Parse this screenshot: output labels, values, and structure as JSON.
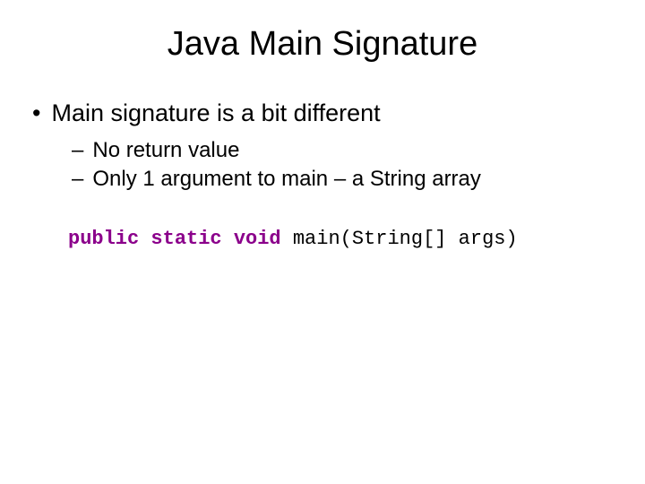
{
  "title": "Java Main Signature",
  "bullet_main": "Main signature is a bit different",
  "sub_bullets": [
    "No return value",
    "Only 1 argument to main – a String array"
  ],
  "code": {
    "keywords": "public static void",
    "rest": " main(String[] args)"
  }
}
